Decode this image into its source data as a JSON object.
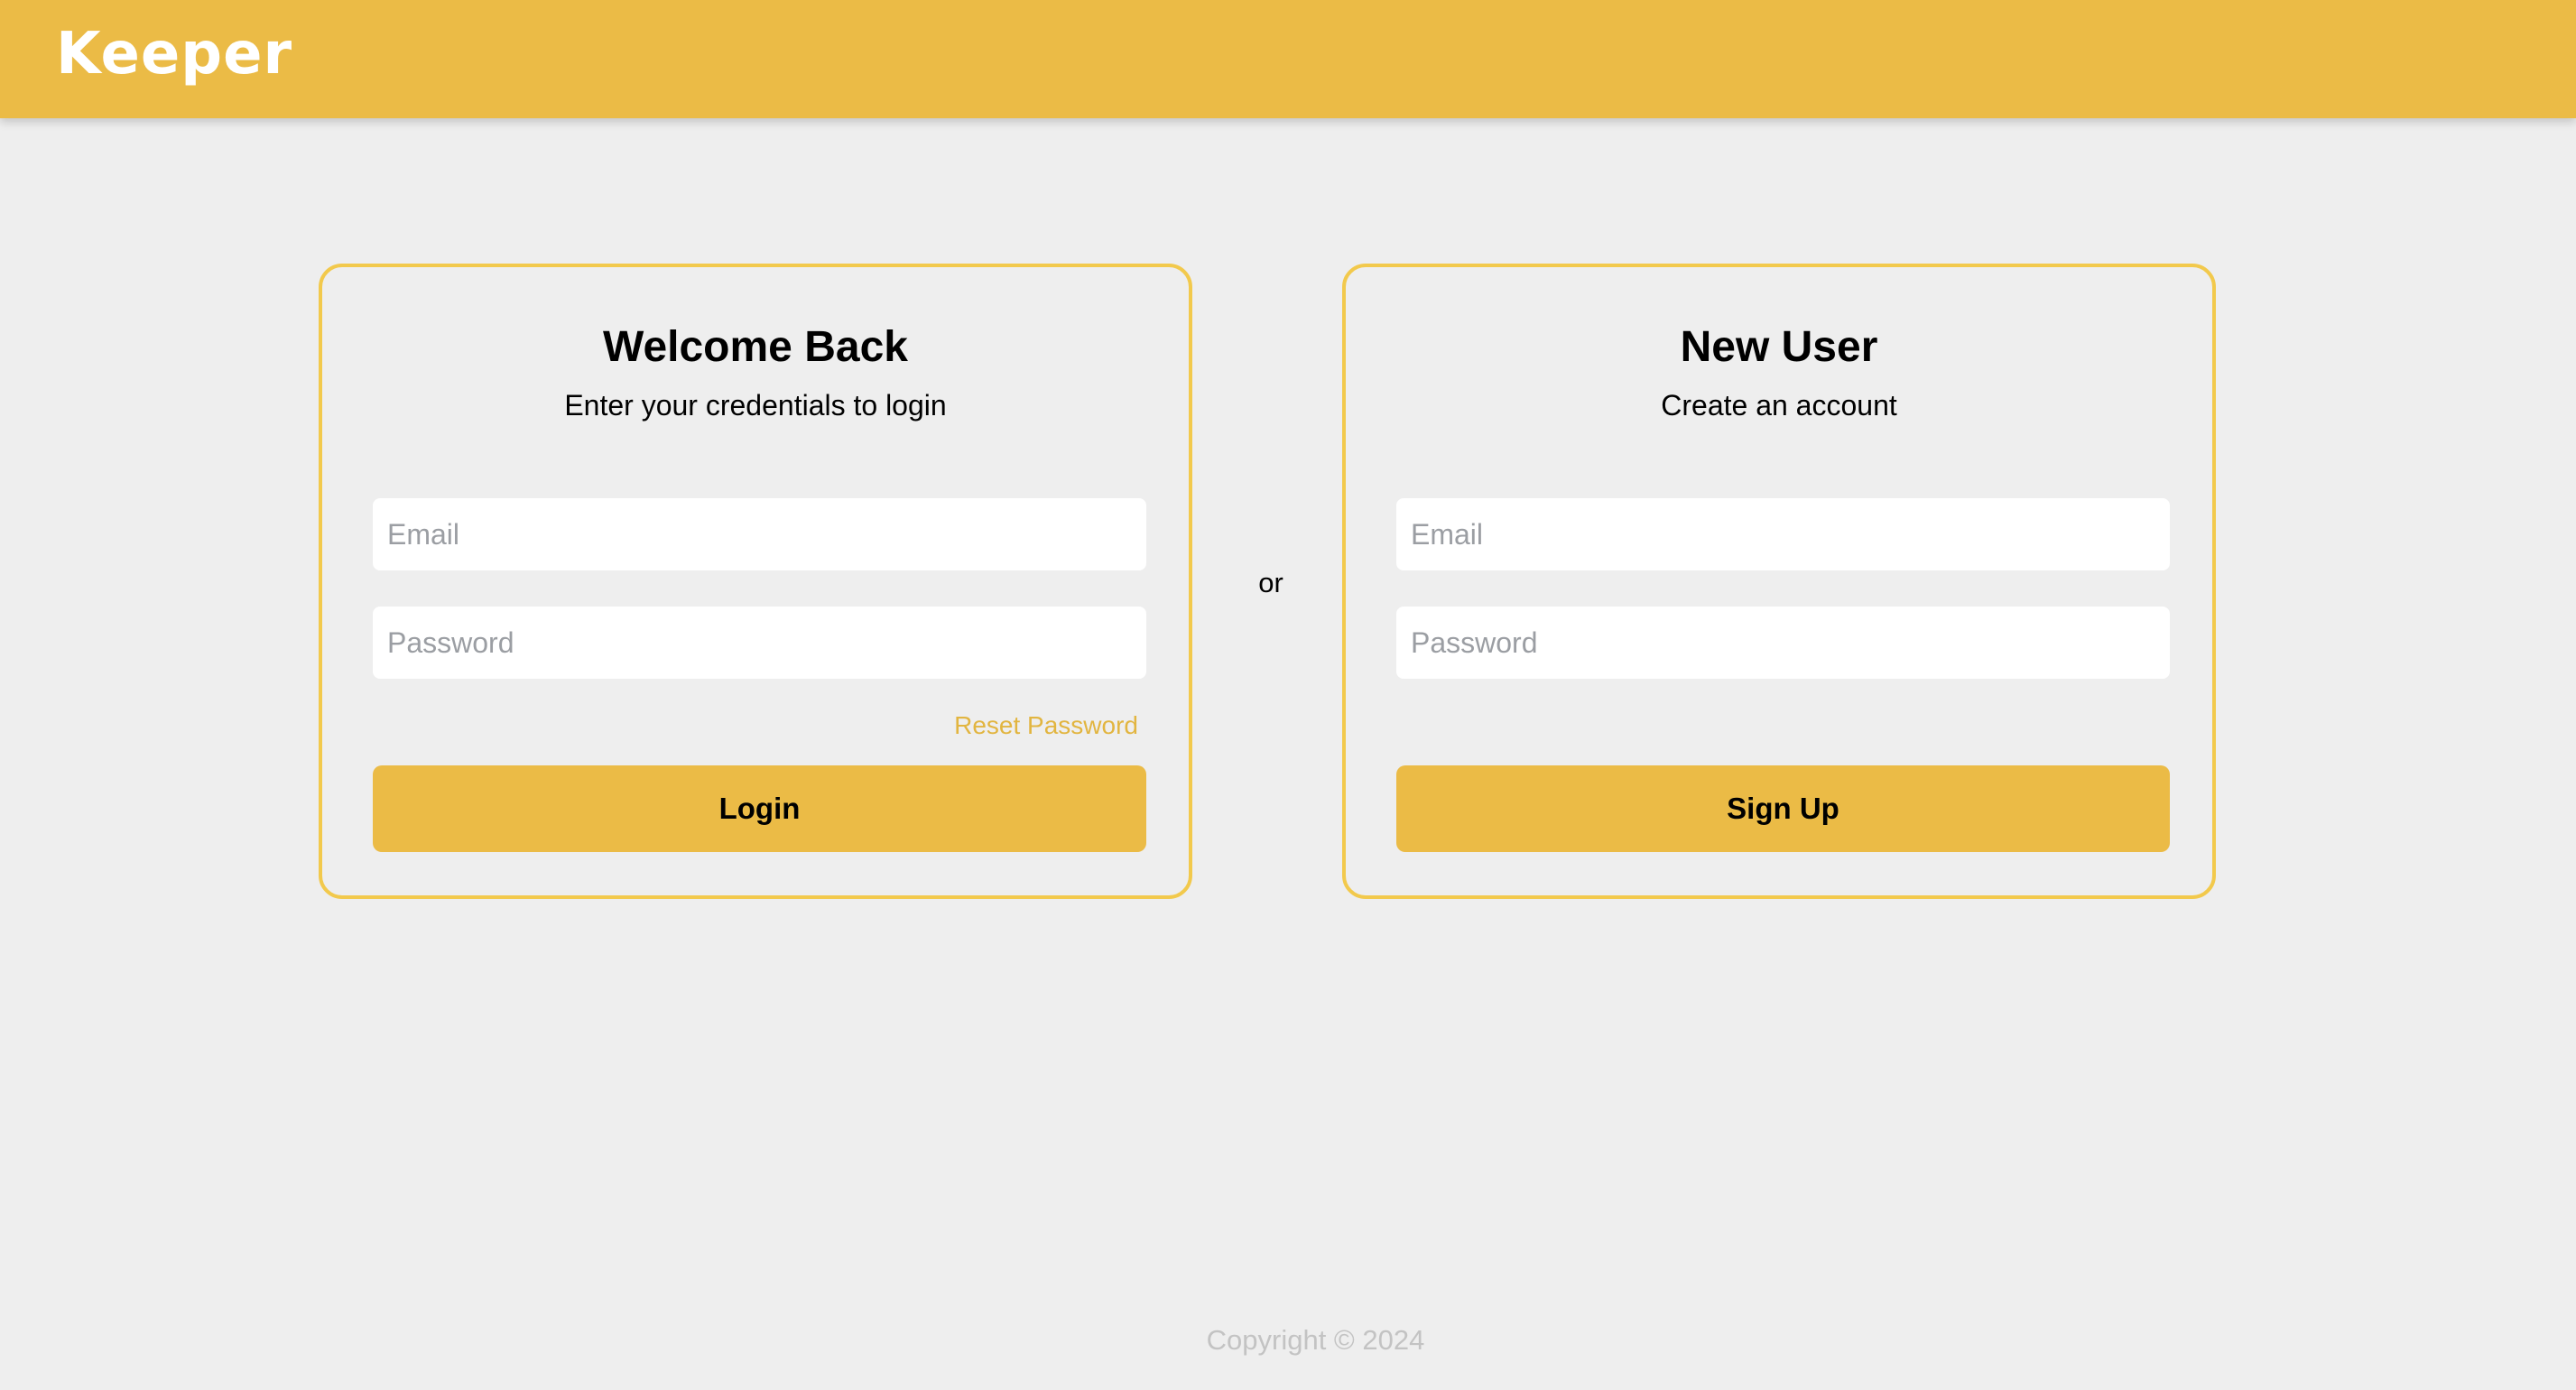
{
  "header": {
    "logo": "Keeper"
  },
  "login_card": {
    "title": "Welcome Back",
    "subtitle": "Enter your credentials to login",
    "email_placeholder": "Email",
    "password_placeholder": "Password",
    "reset_link": "Reset Password",
    "submit_label": "Login"
  },
  "separator": "or",
  "signup_card": {
    "title": "New User",
    "subtitle": "Create an account",
    "email_placeholder": "Email",
    "password_placeholder": "Password",
    "submit_label": "Sign Up"
  },
  "footer": {
    "copyright": "Copyright © 2024"
  },
  "colors": {
    "brand": "#ebbb46",
    "card_border": "#f2c94c",
    "link": "#e2b540",
    "background": "#eeeeee"
  }
}
